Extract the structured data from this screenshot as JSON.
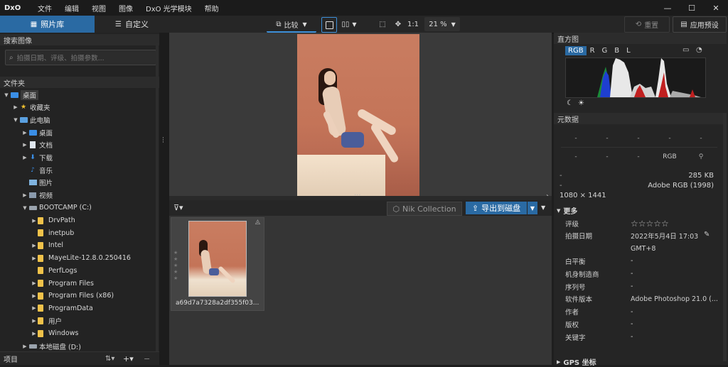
{
  "app": {
    "logo": "DxO"
  },
  "menu": [
    "文件",
    "编辑",
    "视图",
    "图像",
    "DxO 光学模块",
    "帮助"
  ],
  "window_controls": {
    "minimize": "—",
    "maximize": "☐",
    "close": "✕"
  },
  "tabs": {
    "library": "照片库",
    "customize": "自定义"
  },
  "toolbar": {
    "compare": "比较",
    "one_to_one": "1:1",
    "zoom": "21 %",
    "reset": "重置",
    "apply_preset": "应用预设"
  },
  "left": {
    "search_title": "搜索图像",
    "search_placeholder": "拍摄日期、评级、拍摄参数...",
    "folders_title": "文件夹",
    "projects_title": "项目",
    "tree": [
      {
        "label": "桌面",
        "level": 0,
        "arrow": "▼",
        "icon": "desktop-icon",
        "selected": true
      },
      {
        "label": "收藏夹",
        "level": 1,
        "arrow": "▶",
        "icon": "star-icon"
      },
      {
        "label": "此电脑",
        "level": 1,
        "arrow": "▼",
        "icon": "computer-icon"
      },
      {
        "label": "桌面",
        "level": 2,
        "arrow": "▶",
        "icon": "desktop-icon"
      },
      {
        "label": "文档",
        "level": 2,
        "arrow": "▶",
        "icon": "document-icon"
      },
      {
        "label": "下载",
        "level": 2,
        "arrow": "▶",
        "icon": "download-icon"
      },
      {
        "label": "音乐",
        "level": 2,
        "arrow": "",
        "icon": "music-icon"
      },
      {
        "label": "图片",
        "level": 2,
        "arrow": "",
        "icon": "picture-icon"
      },
      {
        "label": "视频",
        "level": 2,
        "arrow": "▶",
        "icon": "video-icon"
      },
      {
        "label": "BOOTCAMP (C:)",
        "level": 2,
        "arrow": "▼",
        "icon": "drive-icon"
      },
      {
        "label": "DrvPath",
        "level": 3,
        "arrow": "▶",
        "icon": "folder-icon"
      },
      {
        "label": "inetpub",
        "level": 3,
        "arrow": "",
        "icon": "folder-icon"
      },
      {
        "label": "Intel",
        "level": 3,
        "arrow": "▶",
        "icon": "folder-icon"
      },
      {
        "label": "MayeLite-12.8.0.250416",
        "level": 3,
        "arrow": "▶",
        "icon": "folder-icon"
      },
      {
        "label": "PerfLogs",
        "level": 3,
        "arrow": "",
        "icon": "folder-icon"
      },
      {
        "label": "Program Files",
        "level": 3,
        "arrow": "▶",
        "icon": "folder-icon"
      },
      {
        "label": "Program Files (x86)",
        "level": 3,
        "arrow": "▶",
        "icon": "folder-icon"
      },
      {
        "label": "ProgramData",
        "level": 3,
        "arrow": "▶",
        "icon": "folder-icon"
      },
      {
        "label": "用户",
        "level": 3,
        "arrow": "▶",
        "icon": "folder-icon"
      },
      {
        "label": "Windows",
        "level": 3,
        "arrow": "▶",
        "icon": "folder-icon"
      },
      {
        "label": "本地磁盘 (D:)",
        "level": 2,
        "arrow": "▶",
        "icon": "drive-icon"
      }
    ]
  },
  "center": {
    "nik": "Nik Collection",
    "export": "导出到磁盘",
    "thumb_name": "a69d7a7328a2df355f03..."
  },
  "right": {
    "histogram_title": "直方图",
    "channels": [
      "RGB",
      "R",
      "G",
      "B",
      "L"
    ],
    "metadata_title": "元数据",
    "meta_grid": [
      [
        "-",
        "-",
        "-",
        "-",
        "-"
      ],
      [
        "-",
        "-",
        "-",
        "RGB",
        ""
      ]
    ],
    "file_size": "285 KB",
    "color_space": "Adobe RGB (1998)",
    "dimensions": "1080 × 1441",
    "more": "更多",
    "fields": [
      {
        "label": "评级",
        "value": "☆☆☆☆☆"
      },
      {
        "label": "拍摄日期",
        "value": "2022年5月4日 17:03"
      },
      {
        "label": "",
        "value": "GMT+8"
      },
      {
        "label": "白平衡",
        "value": "-"
      },
      {
        "label": "机身制造商",
        "value": "-"
      },
      {
        "label": "序列号",
        "value": "-"
      },
      {
        "label": "软件版本",
        "value": "Adobe Photoshop 21.0 (..."
      },
      {
        "label": "作者",
        "value": "-"
      },
      {
        "label": "版权",
        "value": "-"
      },
      {
        "label": "关键字",
        "value": "-"
      }
    ],
    "gps": "GPS 坐标"
  },
  "colors": {
    "accent": "#2a6aa3",
    "panel": "#232323",
    "folder": "#f0c24a"
  }
}
